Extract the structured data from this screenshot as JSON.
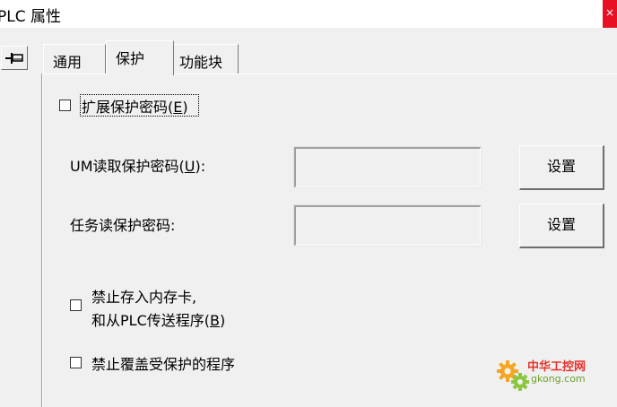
{
  "window": {
    "title": "PLC 属性",
    "close_glyph": "×"
  },
  "tabs": [
    {
      "label": "通用"
    },
    {
      "label": "保护",
      "selected": true
    },
    {
      "label": "功能块"
    }
  ],
  "protect": {
    "extend_pwd": {
      "prefix": "扩展保护密码(",
      "key": "E",
      "suffix": ")",
      "checked": false
    },
    "um_pwd": {
      "prefix": "UM读取保护密码(",
      "key": "U",
      "suffix": "):",
      "value": "",
      "button": "设置"
    },
    "task_pwd": {
      "label": "任务读保护密码:",
      "value": "",
      "button": "设置"
    },
    "prohibit_memcard": {
      "line1": "禁止存入内存卡,",
      "line2_prefix": "和从PLC传送程序(",
      "line2_key": "B",
      "line2_suffix": ")",
      "checked": false
    },
    "prohibit_overwrite": {
      "label": "禁止覆盖受保护的程序",
      "checked": false
    }
  },
  "watermark": {
    "text": "中华工控网",
    "url": "gkong.com"
  },
  "colors": {
    "background": "#f0f0f0",
    "close_button": "#e81123",
    "watermark_red": "#e6312a",
    "watermark_green": "#6d9f2e"
  },
  "icons": [
    "pin-icon",
    "gear-icon"
  ]
}
